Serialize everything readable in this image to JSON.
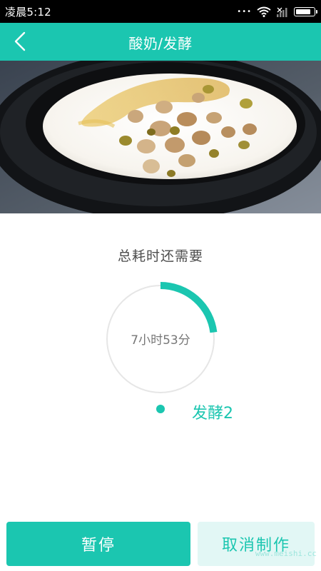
{
  "status_bar": {
    "time": "凌晨5:12",
    "icons": [
      "more-dots-icon",
      "wifi-icon",
      "signal-icon",
      "battery-icon"
    ],
    "battery_level": 0.85
  },
  "header": {
    "back_icon": "chevron-left-icon",
    "title": "酸奶/发酵"
  },
  "hero": {
    "image": "yogurt-bowl-with-nuts-and-honey"
  },
  "timer": {
    "subtitle": "总耗时还需要",
    "remaining": "7小时53分",
    "progress": 0.23,
    "stage": "发酵2"
  },
  "actions": {
    "pause_label": "暂停",
    "cancel_label": "取消制作"
  },
  "watermark": "www.meishi.cc",
  "colors": {
    "accent": "#1bc6b0",
    "ring_track": "#ffffff",
    "status_bar": "#000000"
  }
}
